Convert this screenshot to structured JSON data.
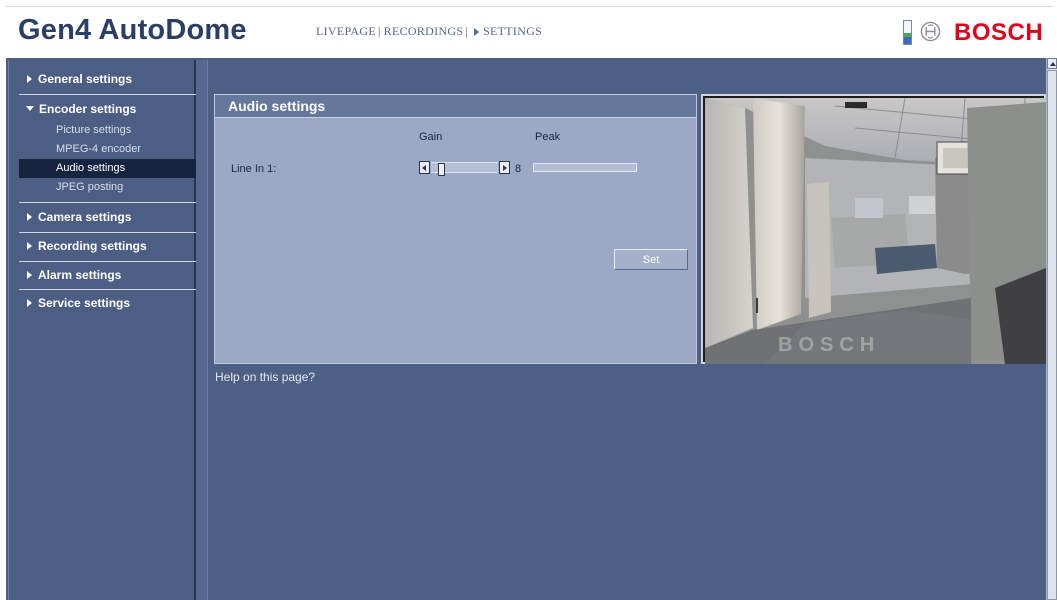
{
  "header": {
    "title": "Gen4 AutoDome",
    "nav": {
      "livepage": "LIVEPAGE",
      "recordings": "RECORDINGS",
      "settings": "SETTINGS",
      "separator": "|"
    },
    "brand": "BOSCH"
  },
  "sidebar": {
    "sections": [
      {
        "label": "General settings",
        "expanded": false
      },
      {
        "label": "Encoder settings",
        "expanded": true
      },
      {
        "label": "Camera settings",
        "expanded": false
      },
      {
        "label": "Recording settings",
        "expanded": false
      },
      {
        "label": "Alarm settings",
        "expanded": false
      },
      {
        "label": "Service settings",
        "expanded": false
      }
    ],
    "encoder_items": [
      {
        "label": "Picture settings",
        "active": false
      },
      {
        "label": "MPEG-4 encoder",
        "active": false
      },
      {
        "label": "Audio settings",
        "active": true
      },
      {
        "label": "JPEG posting",
        "active": false
      }
    ]
  },
  "audio_panel": {
    "title": "Audio settings",
    "gain_label": "Gain",
    "peak_label": "Peak",
    "line_in_label": "Line In 1:",
    "gain_value": "8",
    "gain_level": 0.12,
    "peak_level": 0,
    "set_label": "Set"
  },
  "help_link": "Help on this page?",
  "video": {
    "watermark": "BOSCH"
  },
  "colors": {
    "brand_red": "#e1001a",
    "title_blue": "#2b3f66",
    "frame_blue": "#4d5f85",
    "panel_blue": "#9ba9c6",
    "active_item": "#16243f"
  }
}
